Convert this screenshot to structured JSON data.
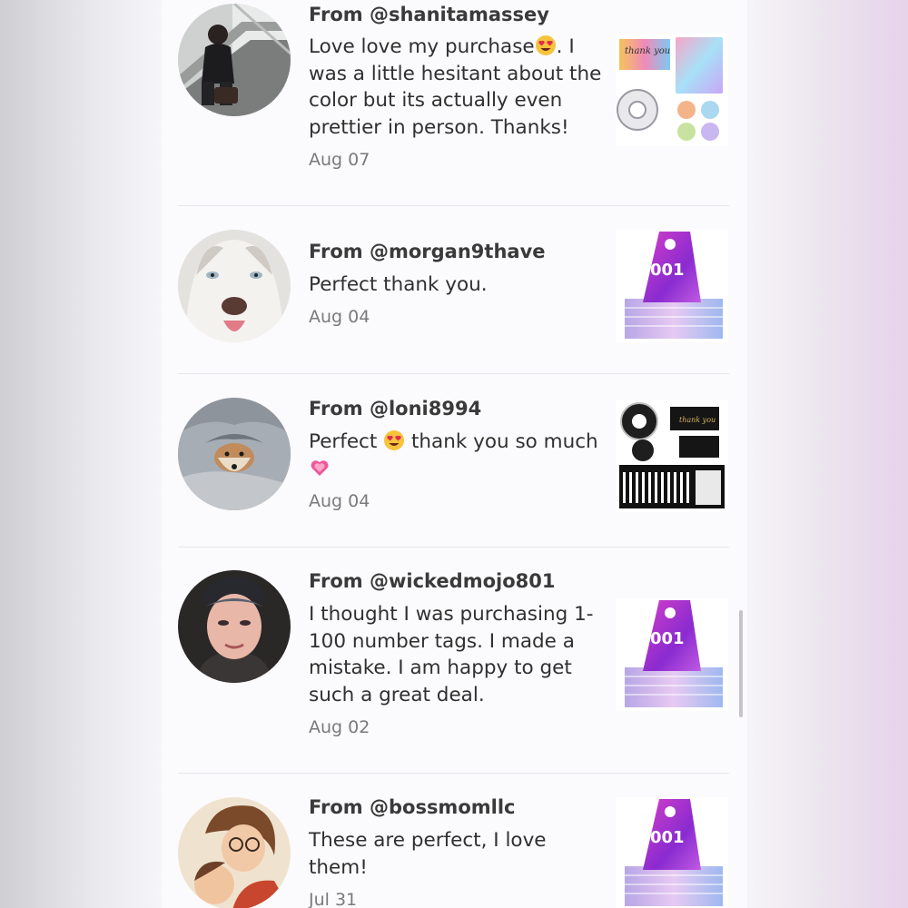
{
  "reviews": [
    {
      "author": "From @shanitamassey",
      "text_before": "Love love my purchase",
      "emoji": "heart-eyes-emoji",
      "text_after": ". I was a little hesitant about the color but its actually even prettier in person. Thanks!",
      "date": "Aug 07",
      "thumb": {
        "card_text": "thank you"
      }
    },
    {
      "author": "From @morgan9thave",
      "text": "Perfect thank you.",
      "date": "Aug 04",
      "thumb": {
        "tag_number": "001"
      }
    },
    {
      "author": "From @loni8994",
      "text_before": "Perfect ",
      "emoji": "heart-eyes-emoji",
      "text_middle": " thank you so much ",
      "emoji2": "growing-heart-emoji",
      "date": "Aug 04",
      "thumb": {
        "card_text": "thank you"
      }
    },
    {
      "author": "From @wickedmojo801",
      "text": "I thought I was purchasing 1-100 number tags. I made a mistake. I am happy to get such a great deal.",
      "date": "Aug 02",
      "thumb": {
        "tag_number": "001"
      }
    },
    {
      "author": "From @bossmomllc",
      "text": "These are perfect, I love them!",
      "date": "Jul 31",
      "thumb": {
        "tag_number": "001"
      }
    }
  ],
  "colors": {
    "panel": "#fbfafc",
    "author": "#3a3a3a",
    "date": "#7a7a7a",
    "tag_purple": "#b43ad6",
    "heart_pink": "#f0569a"
  }
}
